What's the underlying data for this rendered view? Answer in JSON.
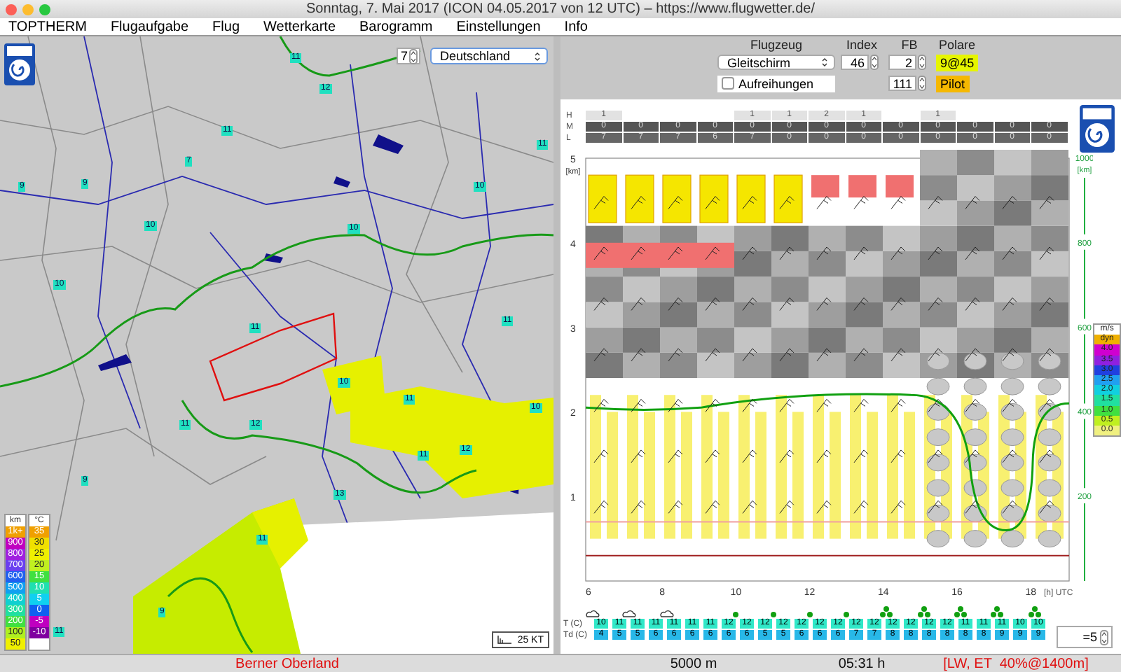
{
  "window": {
    "title": "Sonntag, 7. Mai 2017 (ICON 04.05.2017 von 12 UTC) – https://www.flugwetter.de/"
  },
  "menu": [
    "TOPTHERM",
    "Flugaufgabe",
    "Flug",
    "Wetterkarte",
    "Barogramm",
    "Einstellungen",
    "Info"
  ],
  "map": {
    "day_field": "7",
    "region_select": "Deutschland",
    "wind_scale": "25 KT",
    "labels": [
      "11",
      "11",
      "10",
      "7",
      "9",
      "11",
      "10",
      "11",
      "12",
      "10",
      "11",
      "10",
      "12",
      "11",
      "9",
      "9",
      "11",
      "13",
      "11",
      "11",
      "12",
      "11",
      "9",
      "10",
      "10"
    ],
    "legend": {
      "altitude_unit": "km",
      "altitude": [
        {
          "label": "1k+",
          "color": "#f0a000"
        },
        {
          "label": "900",
          "color": "#c000c0"
        },
        {
          "label": "800",
          "color": "#a020e0"
        },
        {
          "label": "700",
          "color": "#6a40f0"
        },
        {
          "label": "600",
          "color": "#2060f0"
        },
        {
          "label": "500",
          "color": "#10a0f0"
        },
        {
          "label": "400",
          "color": "#10d0d0"
        },
        {
          "label": "300",
          "color": "#20e0a0"
        },
        {
          "label": "200",
          "color": "#40e040"
        },
        {
          "label": "100",
          "color": "#b0f020"
        },
        {
          "label": "50",
          "color": "#f0f000"
        }
      ],
      "temperature_unit": "°C",
      "temperature": [
        {
          "label": "35",
          "color": "#f0a000"
        },
        {
          "label": "30",
          "color": "#f0e000"
        },
        {
          "label": "25",
          "color": "#f0f000"
        },
        {
          "label": "20",
          "color": "#c0f020"
        },
        {
          "label": "15",
          "color": "#40e040"
        },
        {
          "label": "10",
          "color": "#20e0b0"
        },
        {
          "label": "5",
          "color": "#10d0f0"
        },
        {
          "label": "0",
          "color": "#1060f0"
        },
        {
          "label": "-5",
          "color": "#c000c0"
        },
        {
          "label": "-10",
          "color": "#8000a0"
        }
      ]
    }
  },
  "flight_panel": {
    "labels": [
      "Flugzeug",
      "Index",
      "FB",
      "Polare"
    ],
    "aircraft": "Gleitschirm",
    "index": "46",
    "fb": "2",
    "fb_2": "111",
    "polare": "9@45",
    "pilot": "Pilot",
    "aufreihungen": {
      "label": "Aufreihungen",
      "checked": false
    }
  },
  "clouds": {
    "row_labels": [
      "H",
      "M",
      "L"
    ],
    "high": [
      {
        "kind": "cell",
        "value": "1"
      },
      {
        "kind": "gap"
      },
      {
        "kind": "gap"
      },
      {
        "kind": "gap"
      },
      {
        "kind": "cell",
        "value": "1"
      },
      {
        "kind": "cell",
        "value": "1"
      },
      {
        "kind": "cell",
        "value": "2"
      },
      {
        "kind": "cell",
        "value": "1"
      },
      {
        "kind": "gap"
      },
      {
        "kind": "cell",
        "value": "1"
      },
      {
        "kind": "gap"
      },
      {
        "kind": "gap"
      },
      {
        "kind": "gap"
      }
    ],
    "mid": [
      "0",
      "0",
      "0",
      "0",
      "0",
      "0",
      "0",
      "0",
      "0",
      "0",
      "0",
      "0",
      "0"
    ],
    "low": [
      "7",
      "7",
      "7",
      "6",
      "7",
      "0",
      "0",
      "0",
      "0",
      "0",
      "0",
      "0",
      "0"
    ]
  },
  "profile": {
    "y_ticks": [
      "5",
      "4",
      "3",
      "2",
      "1"
    ],
    "y_unit": "[km]",
    "x_ticks": [
      "6",
      "8",
      "10",
      "12",
      "14",
      "16",
      "18"
    ],
    "x_unit": "[h] UTC",
    "right_ticks": [
      "1000",
      "800",
      "600",
      "400",
      "200"
    ],
    "right_unit": "[km]",
    "legend_unit": "m/s",
    "legend": [
      {
        "label": "dyn",
        "color": "#f0b000"
      },
      {
        "label": "4.0",
        "color": "#d000d0"
      },
      {
        "label": "3.5",
        "color": "#9020e0"
      },
      {
        "label": "3.0",
        "color": "#2040e0"
      },
      {
        "label": "2.5",
        "color": "#20a0f0"
      },
      {
        "label": "2.0",
        "color": "#10d0e0"
      },
      {
        "label": "1.5",
        "color": "#20e0a0"
      },
      {
        "label": "1.0",
        "color": "#40e040"
      },
      {
        "label": "0.5",
        "color": "#c0f020"
      },
      {
        "label": "0.0",
        "color": "#f0f080"
      }
    ]
  },
  "weather": [
    {
      "kind": "cloud"
    },
    {
      "kind": "cloud"
    },
    {
      "kind": "cloud"
    },
    {
      "kind": "none"
    },
    {
      "kind": "dot"
    },
    {
      "kind": "dot"
    },
    {
      "kind": "dot"
    },
    {
      "kind": "dot"
    },
    {
      "kind": "cluster"
    },
    {
      "kind": "cluster"
    },
    {
      "kind": "cluster"
    },
    {
      "kind": "cluster"
    },
    {
      "kind": "cluster"
    }
  ],
  "temps": {
    "t_label": "T (C)",
    "td_label": "Td (C)",
    "t": [
      "10",
      "11",
      "11",
      "11",
      "11",
      "11",
      "11",
      "12",
      "12",
      "12",
      "12",
      "12",
      "12",
      "12",
      "12",
      "12",
      "12",
      "12",
      "12",
      "12",
      "11",
      "11",
      "11",
      "10",
      "10"
    ],
    "td": [
      "4",
      "5",
      "5",
      "6",
      "6",
      "6",
      "6",
      "6",
      "6",
      "5",
      "5",
      "6",
      "6",
      "6",
      "7",
      "7",
      "8",
      "8",
      "8",
      "8",
      "8",
      "8",
      "9",
      "9",
      "9"
    ]
  },
  "step_field": "=5",
  "status_bar": [
    {
      "text": "Berner Oberland",
      "warning": true
    },
    {
      "text": "5000 m",
      "warning": false
    },
    {
      "text": "05:31 h",
      "warning": false
    },
    {
      "text": "[LW, ET  40%@1400m]",
      "warning": true
    }
  ]
}
